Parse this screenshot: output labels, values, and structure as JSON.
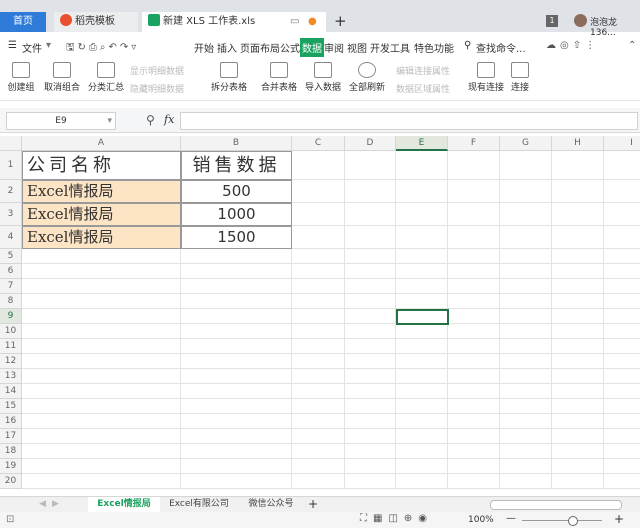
{
  "tabs": {
    "home": "首页",
    "template": "稻壳模板",
    "file": "新建 XLS 工作表.xls",
    "badge": "1",
    "user": "泡泡龙136..."
  },
  "menu": {
    "file": "文件",
    "items": [
      "开始",
      "插入",
      "页面布局",
      "公式",
      "数据",
      "审阅",
      "视图",
      "开发工具",
      "特色功能"
    ],
    "active": "数据",
    "search": "查找命令..."
  },
  "ribbon": {
    "create_group": "创建组",
    "ungroup": "取消组合",
    "subtotal": "分类汇总",
    "show_detail": "显示明细数据",
    "hide_detail": "隐藏明细数据",
    "split_table": "拆分表格",
    "merge_table": "合并表格",
    "import_data": "导入数据",
    "refresh_all": "全部刷新",
    "edit_link_props": "编辑连接属性",
    "range_props": "数据区域属性",
    "existing_conn": "现有连接",
    "connect": "连接"
  },
  "formula_bar": {
    "name_box": "E9",
    "fx": "fx",
    "value": ""
  },
  "columns": [
    "A",
    "B",
    "C",
    "D",
    "E",
    "F",
    "G",
    "H",
    "I"
  ],
  "rows": [
    "1",
    "2",
    "3",
    "4",
    "5",
    "6",
    "7",
    "8",
    "9",
    "10",
    "11",
    "12",
    "13",
    "14",
    "15",
    "16",
    "17",
    "18",
    "19",
    "20"
  ],
  "table": {
    "header": [
      "公司名称",
      "销售数据"
    ],
    "rows": [
      [
        "Excel情报局",
        "500"
      ],
      [
        "Excel情报局",
        "1000"
      ],
      [
        "Excel情报局",
        "1500"
      ]
    ]
  },
  "selected_cell": "E9",
  "sheets": [
    "Excel情报局",
    "Excel有限公司",
    "微信公众号"
  ],
  "active_sheet": "Excel情报局",
  "status": {
    "zoom": "100%"
  },
  "colors": {
    "accent": "#2f7bd9",
    "active_tab": "#1aa260",
    "cell_fill": "#fce4c4",
    "selection": "#217346"
  }
}
